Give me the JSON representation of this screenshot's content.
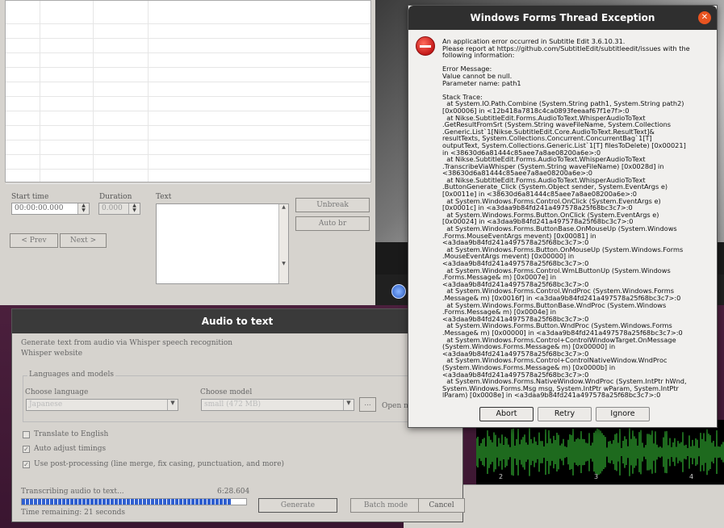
{
  "main_window": {
    "start_time_label": "Start time",
    "start_time_value": "00:00:00.000",
    "duration_label": "Duration",
    "duration_value": "0.000",
    "text_label": "Text",
    "unbreak_label": "Unbreak",
    "auto_br_label": "Auto br",
    "prev_label": "< Prev",
    "next_label": "Next >"
  },
  "audio_to_text": {
    "title": "Audio to text",
    "description": "Generate text from audio via Whisper speech recognition",
    "whisper_link": "Whisper website",
    "group_label": "Languages and models",
    "choose_language_label": "Choose language",
    "language_value": "Japanese",
    "choose_model_label": "Choose model",
    "model_value": "small (472 MB)",
    "browse_label": "...",
    "open_models_label": "Open m",
    "translate_label": "Translate to English",
    "translate_checked": false,
    "auto_adjust_label": "Auto adjust timings",
    "auto_adjust_checked": true,
    "post_processing_label": "Use post-processing (line merge, fix casing, punctuation, and more)",
    "post_processing_checked": true,
    "progress_label": "Transcribing audio to text...",
    "progress_time": "6:28.604",
    "progress_fraction": 0.93,
    "remaining_label": "Time remaining: 21 seconds",
    "generate_label": "Generate",
    "batch_label": "Batch mode",
    "cancel_label": "Cancel"
  },
  "exception_dialog": {
    "title": "Windows Forms Thread Exception",
    "close_icon": "close-icon",
    "error_icon": "error-icon",
    "message": "An application error occurred in Subtitle Edit 3.6.10.31.\nPlease report at https://github.com/SubtitleEdit/subtitleedit/issues with the\nfollowing information:\n\nError Message:\nValue cannot be null.\nParameter name: path1\n\nStack Trace:\n  at System.IO.Path.Combine (System.String path1, System.String path2)\n[0x00006] in <12b418a7818c4ca0893feeaaf67f1e7f>:0\n  at Nikse.SubtitleEdit.Forms.AudioToText.WhisperAudioToText\n.GetResultFromSrt (System.String waveFileName, System.Collections\n.Generic.List`1[Nikse.SubtitleEdit.Core.AudioToText.ResultText]&\nresultTexts, System.Collections.Concurrent.ConcurrentBag`1[T]\noutputText, System.Collections.Generic.List`1[T] filesToDelete) [0x00021]\nin <38630d6a81444c85aee7a8ae08200a6e>:0\n  at Nikse.SubtitleEdit.Forms.AudioToText.WhisperAudioToText\n.TranscribeViaWhisper (System.String waveFileName) [0x0028d] in\n<38630d6a81444c85aee7a8ae08200a6e>:0\n  at Nikse.SubtitleEdit.Forms.AudioToText.WhisperAudioToText\n.ButtonGenerate_Click (System.Object sender, System.EventArgs e)\n[0x0011e] in <38630d6a81444c85aee7a8ae08200a6e>:0\n  at System.Windows.Forms.Control.OnClick (System.EventArgs e)\n[0x0001c] in <a3daa9b84fd241a497578a25f68bc3c7>:0\n  at System.Windows.Forms.Button.OnClick (System.EventArgs e)\n[0x00024] in <a3daa9b84fd241a497578a25f68bc3c7>:0\n  at System.Windows.Forms.ButtonBase.OnMouseUp (System.Windows\n.Forms.MouseEventArgs mevent) [0x00081] in\n<a3daa9b84fd241a497578a25f68bc3c7>:0\n  at System.Windows.Forms.Button.OnMouseUp (System.Windows.Forms\n.MouseEventArgs mevent) [0x00000] in\n<a3daa9b84fd241a497578a25f68bc3c7>:0\n  at System.Windows.Forms.Control.WmLButtonUp (System.Windows\n.Forms.Message& m) [0x0007e] in\n<a3daa9b84fd241a497578a25f68bc3c7>:0\n  at System.Windows.Forms.Control.WndProc (System.Windows.Forms\n.Message& m) [0x0016f] in <a3daa9b84fd241a497578a25f68bc3c7>:0\n  at System.Windows.Forms.ButtonBase.WndProc (System.Windows\n.Forms.Message& m) [0x0004e] in\n<a3daa9b84fd241a497578a25f68bc3c7>:0\n  at System.Windows.Forms.Button.WndProc (System.Windows.Forms\n.Message& m) [0x00000] in <a3daa9b84fd241a497578a25f68bc3c7>:0\n  at System.Windows.Forms.Control+ControlWindowTarget.OnMessage\n(System.Windows.Forms.Message& m) [0x00000] in\n<a3daa9b84fd241a497578a25f68bc3c7>:0\n  at System.Windows.Forms.Control+ControlNativeWindow.WndProc\n(System.Windows.Forms.Message& m) [0x0000b] in\n<a3daa9b84fd241a497578a25f68bc3c7>:0\n  at System.Windows.Forms.NativeWindow.WndProc (System.IntPtr hWnd,\nSystem.Windows.Forms.Msg msg, System.IntPtr wParam, System.IntPtr\nlParam) [0x0008e] in <a3daa9b84fd241a497578a25f68bc3c7>:0",
    "abort_label": "Abort",
    "retry_label": "Retry",
    "ignore_label": "Ignore"
  },
  "waveform": {
    "tick_labels": [
      "2",
      "3",
      "4"
    ]
  },
  "colors": {
    "accent_close": "#e95420",
    "progress_fill": "#2f5fd0",
    "waveform_green": "#3bd43b"
  }
}
